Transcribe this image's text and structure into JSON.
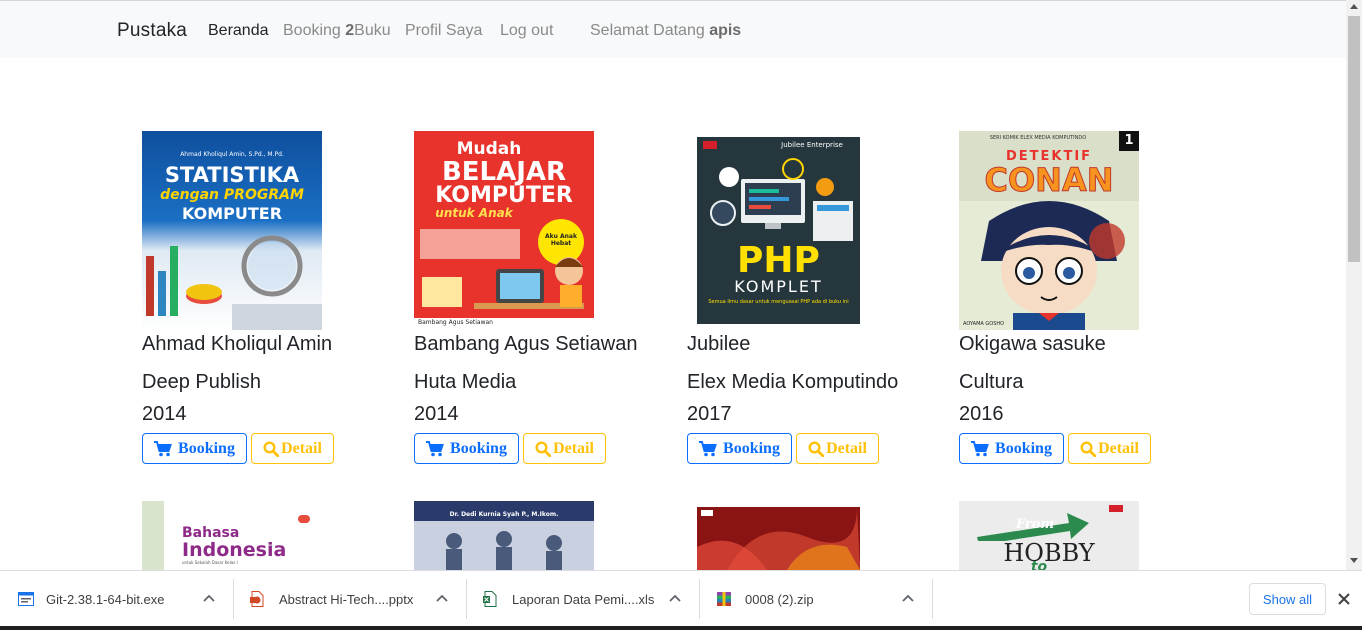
{
  "navbar": {
    "brand": "Pustaka",
    "home": "Beranda",
    "booking_prefix": "Booking ",
    "booking_count": "2",
    "booking_suffix": "Buku",
    "profile": "Profil Saya",
    "logout": "Log out",
    "welcome_prefix": "Selamat Datang ",
    "username": "apis"
  },
  "books": [
    {
      "author": "Ahmad Kholiqul Amin",
      "publisher": "Deep Publish",
      "year": "2014",
      "booking_label": "Booking",
      "detail_label": "Detail",
      "cover": {
        "line1": "Ahmad Kholiqul Amin, S.Pd., M.Pd.",
        "line2": "STATISTIKA",
        "line3": "dengan PROGRAM",
        "line4": "KOMPUTER"
      }
    },
    {
      "author": "Bambang Agus Setiawan",
      "publisher": "Huta Media",
      "year": "2014",
      "booking_label": "Booking",
      "detail_label": "Detail",
      "cover": {
        "line1": "Mudah",
        "line2": "BELAJAR",
        "line3": "KOMPUTER",
        "line4": "untuk Anak",
        "badge": "Aku Anak Hebat",
        "footer": "Bambang Agus Setiawan"
      }
    },
    {
      "author": "Jubilee",
      "publisher": "Elex Media Komputindo",
      "year": "2017",
      "booking_label": "Booking",
      "detail_label": "Detail",
      "cover": {
        "line1": "Jubilee Enterprise",
        "line2": "PHP",
        "line3": "KOMPLET",
        "line4": "Semua ilmu dasar untuk menguasai PHP ada di buku ini"
      }
    },
    {
      "author": "Okigawa sasuke",
      "publisher": "Cultura",
      "year": "2016",
      "booking_label": "Booking",
      "detail_label": "Detail",
      "cover": {
        "line1": "SERI KOMIK ELEX MEDIA KOMPUTINDO",
        "line2": "DETEKTIF",
        "line3": "CONAN",
        "line4": "1",
        "footer": "AOYAMA GOSHO"
      }
    }
  ],
  "books_row2": [
    {
      "cover": {
        "line1": "Bahasa",
        "line2": "Indonesia",
        "line3": "untuk Sekolah Dasar Kelas I"
      }
    },
    {
      "cover": {
        "line1": "Dr. Dedi Kurnia Syah P., M.Ikom."
      }
    },
    {
      "cover": {
        "line1": ""
      }
    },
    {
      "cover": {
        "line1": "From",
        "line2": "HOBBY",
        "line3": "to"
      }
    }
  ],
  "downloads": [
    {
      "name": "Git-2.38.1-64-bit.exe",
      "icon": "exe-file-icon"
    },
    {
      "name": "Abstract Hi-Tech....pptx",
      "icon": "pptx-file-icon"
    },
    {
      "name": "Laporan Data Pemi....xls",
      "icon": "xls-file-icon"
    },
    {
      "name": "0008 (2).zip",
      "icon": "zip-file-icon"
    }
  ],
  "download_bar": {
    "show_all": "Show all"
  },
  "colors": {
    "primary": "#0d6efd",
    "warning": "#ffc107",
    "navbar_bg": "#f8f9fa"
  }
}
